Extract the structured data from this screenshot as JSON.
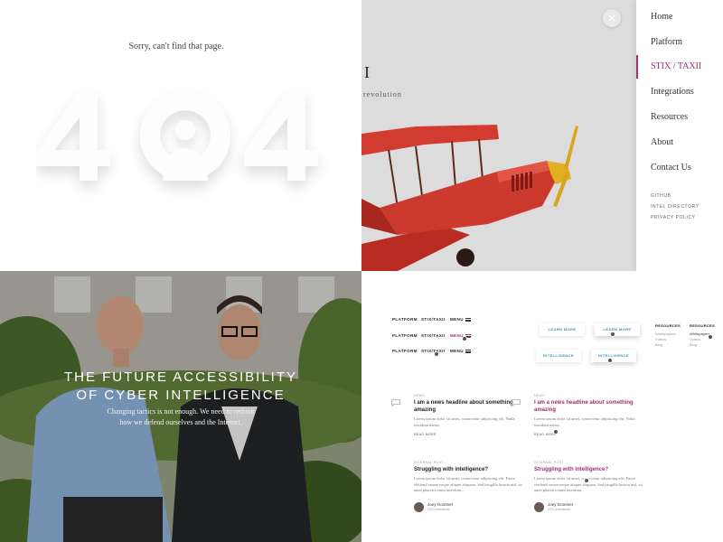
{
  "error_page": {
    "message": "Sorry, can't find that page.",
    "code": "404"
  },
  "hero": {
    "title_fragment": "II",
    "subtitle_fragment": "revolution"
  },
  "nav_menu": {
    "items": [
      {
        "label": "Home"
      },
      {
        "label": "Platform"
      },
      {
        "label": "STIX / TAXII"
      },
      {
        "label": "Integrations"
      },
      {
        "label": "Resources"
      },
      {
        "label": "About"
      },
      {
        "label": "Contact Us"
      }
    ],
    "active_index": 2,
    "secondary": [
      "GITHUB",
      "INTEL DIRECTORY",
      "PRIVACY POLICY"
    ]
  },
  "photo_banner": {
    "headline_line1": "THE FUTURE ACCESSIBILITY",
    "headline_line2": "OF CYBER INTELLIGENCE",
    "sub_line1": "Changing tactics is not enough. We need to rethink",
    "sub_line2": "how we defend ourselves and the Internet."
  },
  "styleguide": {
    "mini_nav": {
      "platform": "PLATFORM",
      "stix": "STIX/TAXII",
      "menu": "MENU"
    },
    "buttons": {
      "learn_more": "LEARN MORE",
      "intelligence": "INTELLIGENCE"
    },
    "footer_col": {
      "heading": "RESOURCES",
      "links": [
        "Whitepapers",
        "Videos",
        "Blog"
      ]
    },
    "news_cards": [
      {
        "category": "NEWS",
        "title": "I am a news headline about something amazing",
        "excerpt": "Lorem ipsum dolor sit amet, consectetur adipiscing elit. Nulla tincidunt metus.",
        "read_more": "READ MORE"
      },
      {
        "category": "NEWS",
        "title": "I am a news headline about something amazing",
        "excerpt": "Lorem ipsum dolor sit amet, consectetur adipiscing elit. Nulla tincidunt metus.",
        "read_more": "READ MORE"
      }
    ],
    "post_cards": [
      {
        "category": "INTERNAL POST",
        "title": "Struggling with intelligence?",
        "excerpt": "Lorem ipsum dolor sit amet, consectetur adipiscing elit. Fusce eleifend ornare neque aliquet aliquam. Sed fringilla lacinia nisl, sit amet pharetra enim interdum...",
        "author": "Joey Gommer",
        "role": "CEO Interstellar"
      },
      {
        "category": "INTERNAL POST",
        "title": "Struggling with intelligence?",
        "excerpt": "Lorem ipsum dolor sit amet, consectetur adipiscing elit. Fusce eleifend ornare neque aliquet aliquam. Sed fringilla lacinia nisl, sit amet pharetra enim interdum...",
        "author": "Joey Gommer",
        "role": "CEO Interstellar"
      }
    ]
  },
  "colors": {
    "accent": "#a0306e",
    "link_blue": "#3d8fb5",
    "plane_red": "#c8342a"
  }
}
